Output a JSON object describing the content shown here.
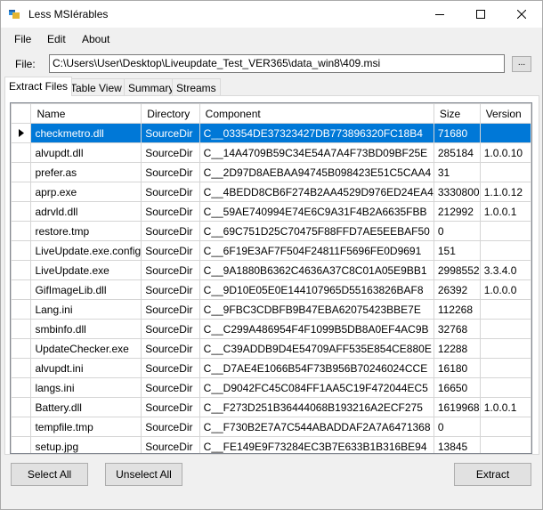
{
  "window": {
    "title": "Less MSIérables"
  },
  "menu": [
    "File",
    "Edit",
    "About"
  ],
  "file": {
    "label": "File:",
    "path": "C:\\Users\\User\\Desktop\\Liveupdate_Test_VER365\\data_win8\\409.msi",
    "browse_label": "..."
  },
  "tabs": [
    "Extract Files",
    "Table View",
    "Summary",
    "Streams"
  ],
  "active_tab": 0,
  "grid": {
    "columns": [
      "Name",
      "Directory",
      "Component",
      "Size",
      "Version"
    ],
    "selected_row": 0,
    "rows": [
      [
        "checkmetro.dll",
        "SourceDir",
        "C__03354DE37323427DB773896320FC18B4",
        "71680",
        ""
      ],
      [
        "alvupdt.dll",
        "SourceDir",
        "C__14A4709B59C34E54A7A4F73BD09BF25E",
        "285184",
        "1.0.0.10"
      ],
      [
        "prefer.as",
        "SourceDir",
        "C__2D97D8AEBAA94745B098423E51C5CAA4",
        "31",
        ""
      ],
      [
        "aprp.exe",
        "SourceDir",
        "C__4BEDD8CB6F274B2AA4529D976ED24EA4",
        "3330800",
        "1.1.0.12"
      ],
      [
        "adrvld.dll",
        "SourceDir",
        "C__59AE740994E74E6C9A31F4B2A6635FBB",
        "212992",
        "1.0.0.1"
      ],
      [
        "restore.tmp",
        "SourceDir",
        "C__69C751D25C70475F88FFD7AE5EEBAF50",
        "0",
        ""
      ],
      [
        "LiveUpdate.exe.config",
        "SourceDir",
        "C__6F19E3AF7F504F24811F5696FE0D9691",
        "151",
        ""
      ],
      [
        "LiveUpdate.exe",
        "SourceDir",
        "C__9A1880B6362C4636A37C8C01A05E9BB1",
        "2998552",
        "3.3.4.0"
      ],
      [
        "GifImageLib.dll",
        "SourceDir",
        "C__9D10E05E0E144107965D55163826BAF8",
        "26392",
        "1.0.0.0"
      ],
      [
        "Lang.ini",
        "SourceDir",
        "C__9FBC3CDBFB9B47EBA62075423BBE7E",
        "112268",
        ""
      ],
      [
        "smbinfo.dll",
        "SourceDir",
        "C__C299A486954F4F1099B5DB8A0EF4AC9B",
        "32768",
        ""
      ],
      [
        "UpdateChecker.exe",
        "SourceDir",
        "C__C39ADDB9D4E54709AFF535E854CE880E",
        "12288",
        ""
      ],
      [
        "alvupdt.ini",
        "SourceDir",
        "C__D7AE4E1066B54F73B956B70246024CCE",
        "16180",
        ""
      ],
      [
        "langs.ini",
        "SourceDir",
        "C__D9042FC45C084FF1AA5C19F472044EC5",
        "16650",
        ""
      ],
      [
        "Battery.dll",
        "SourceDir",
        "C__F273D251B36444068B193216A2ECF275",
        "1619968",
        "1.0.0.1"
      ],
      [
        "tempfile.tmp",
        "SourceDir",
        "C__F730B2E7A7C544ABADDAF2A7A6471368",
        "0",
        ""
      ],
      [
        "setup.jpg",
        "SourceDir",
        "C__FE149E9F73284EC3B7E633B1B316BE94",
        "13845",
        ""
      ]
    ]
  },
  "buttons": {
    "select_all": "Select All",
    "unselect_all": "Unselect All",
    "extract": "Extract"
  },
  "icons": {
    "current_row": "row-pointer-icon",
    "app": "app-icon",
    "minimize": "minimize-icon",
    "maximize": "maximize-icon",
    "close": "close-icon"
  },
  "colors": {
    "selection": "#0078d7"
  }
}
